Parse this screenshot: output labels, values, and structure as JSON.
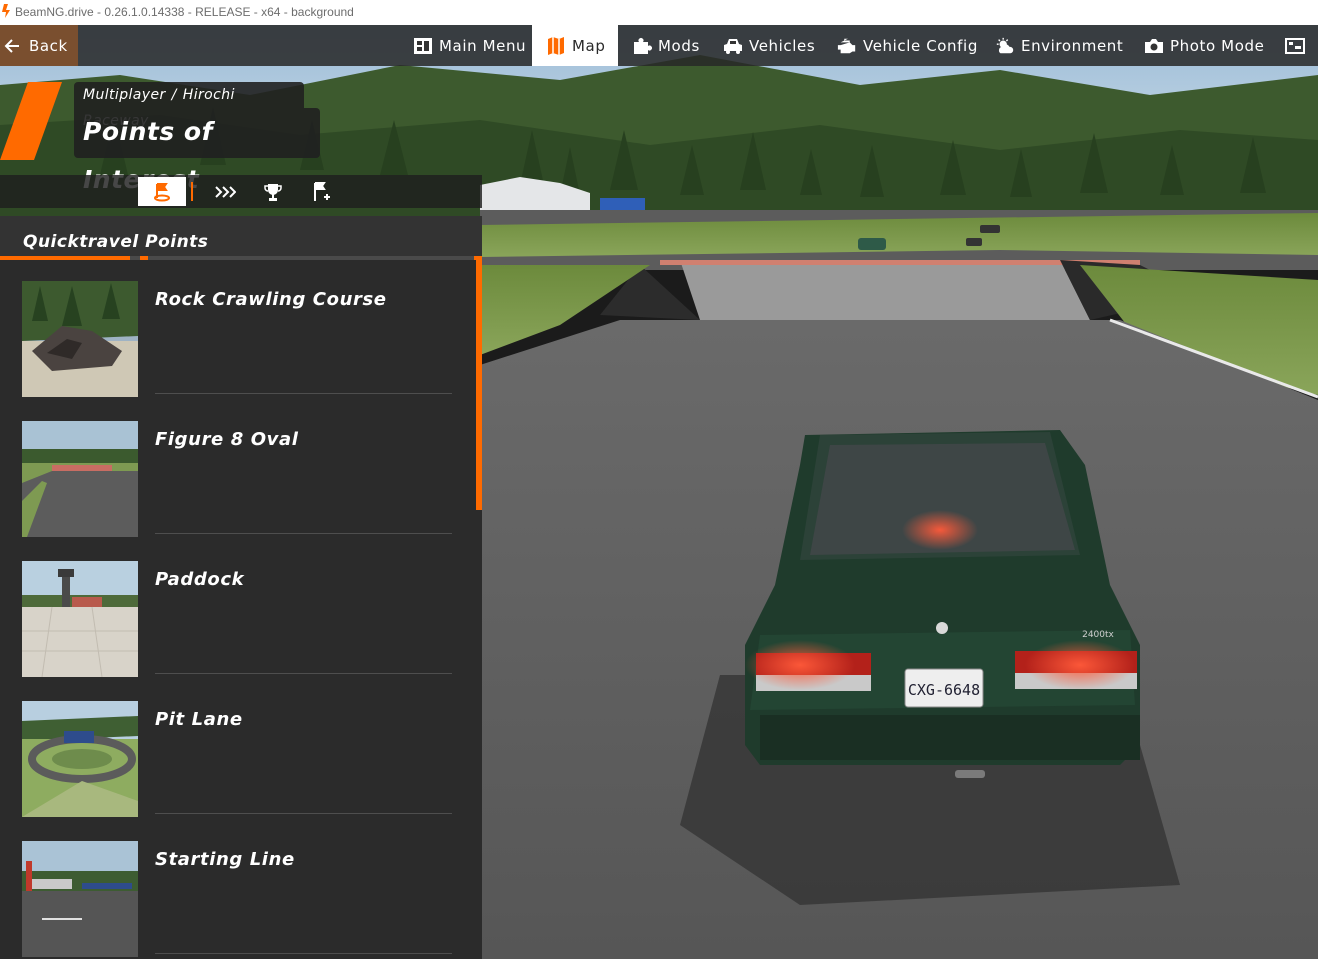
{
  "window": {
    "title": "BeamNG.drive - 0.26.1.0.14338 - RELEASE - x64 - background"
  },
  "topbar": {
    "back_label": "Back",
    "nav": [
      {
        "label": "Main Menu",
        "icon": "main-menu-icon",
        "active": false
      },
      {
        "label": "Map",
        "icon": "map-icon",
        "active": true
      },
      {
        "label": "Mods",
        "icon": "puzzle-icon",
        "active": false
      },
      {
        "label": "Vehicles",
        "icon": "car-icon",
        "active": false
      },
      {
        "label": "Vehicle Config",
        "icon": "engine-icon",
        "active": false
      },
      {
        "label": "Environment",
        "icon": "weather-icon",
        "active": false
      },
      {
        "label": "Photo Mode",
        "icon": "camera-icon",
        "active": false
      }
    ],
    "accent_color": "#ff6a00",
    "back_color": "#7a4f2f"
  },
  "header": {
    "breadcrumb_parent": "Multiplayer",
    "breadcrumb_separator": "/",
    "breadcrumb_current": "Hirochi Raceway",
    "title": "Points of Interest"
  },
  "toolbar": {
    "tools": [
      {
        "icon": "quicktravel-flag-icon",
        "active": true
      },
      {
        "icon": "chevrons-right-icon",
        "active": false
      },
      {
        "icon": "trophy-icon",
        "active": false
      },
      {
        "icon": "add-flag-icon",
        "active": false
      }
    ]
  },
  "panel": {
    "title": "Quicktravel Points",
    "items": [
      {
        "label": "Rock Crawling Course",
        "thumb": "rock-crawl"
      },
      {
        "label": "Figure 8 Oval",
        "thumb": "figure8"
      },
      {
        "label": "Paddock",
        "thumb": "paddock"
      },
      {
        "label": "Pit Lane",
        "thumb": "pitlane"
      },
      {
        "label": "Starting Line",
        "thumb": "starting"
      }
    ]
  },
  "scene": {
    "license_plate": "CXG-6648",
    "badge": "2400tx"
  }
}
